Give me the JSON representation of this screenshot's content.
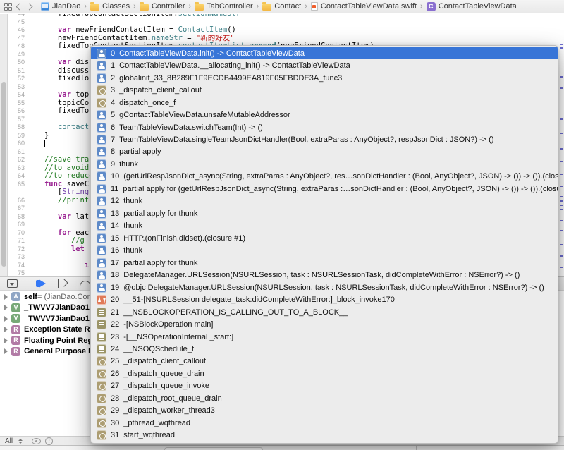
{
  "jumpbar": {
    "items": [
      {
        "icon": "project-icon",
        "label": "JianDao"
      },
      {
        "icon": "folder-icon",
        "label": "Classes"
      },
      {
        "icon": "folder-icon",
        "label": "Controller"
      },
      {
        "icon": "folder-icon",
        "label": "TabController"
      },
      {
        "icon": "folder-icon",
        "label": "Contact"
      },
      {
        "icon": "swift-file-icon",
        "label": "ContactTableViewData.swift"
      },
      {
        "icon": "class-icon",
        "label": "ContactTableViewData"
      }
    ]
  },
  "editor": {
    "lines": [
      {
        "n": "44",
        "seg": [
          [
            "n",
            "      fixedTopContactSectionItem."
          ],
          [
            "p",
            "sectionNameStr"
          ]
        ]
      },
      {
        "n": "45",
        "seg": []
      },
      {
        "n": "46",
        "seg": [
          [
            "n",
            "      "
          ],
          [
            "k",
            "var"
          ],
          [
            "n",
            " newFriendContactItem = "
          ],
          [
            "t",
            "ContactItem"
          ],
          [
            "n",
            "()"
          ]
        ]
      },
      {
        "n": "47",
        "seg": [
          [
            "n",
            "      newFriendContactItem."
          ],
          [
            "p",
            "nameStr"
          ],
          [
            "n",
            " = "
          ],
          [
            "s",
            "\"新的好友\""
          ]
        ]
      },
      {
        "n": "48",
        "seg": [
          [
            "n",
            "      fixedTopContactSectionItem."
          ],
          [
            "p",
            "contactItemList"
          ],
          [
            "n",
            "."
          ],
          [
            "pb",
            "append"
          ],
          [
            "n",
            "(newFriendContactItem)"
          ]
        ]
      },
      {
        "n": "49",
        "seg": []
      },
      {
        "n": "50",
        "seg": [
          [
            "n",
            "      "
          ],
          [
            "k",
            "var"
          ],
          [
            "n",
            " dis"
          ]
        ]
      },
      {
        "n": "51",
        "seg": [
          [
            "n",
            "      discuss"
          ]
        ]
      },
      {
        "n": "52",
        "seg": [
          [
            "n",
            "      fixedTo"
          ]
        ]
      },
      {
        "n": "53",
        "seg": []
      },
      {
        "n": "54",
        "seg": [
          [
            "n",
            "      "
          ],
          [
            "k",
            "var"
          ],
          [
            "n",
            " top"
          ]
        ]
      },
      {
        "n": "55",
        "seg": [
          [
            "n",
            "      topicCo"
          ]
        ]
      },
      {
        "n": "56",
        "seg": [
          [
            "n",
            "      fixedTo"
          ]
        ]
      },
      {
        "n": "57",
        "seg": []
      },
      {
        "n": "58",
        "seg": [
          [
            "n",
            "      "
          ],
          [
            "p",
            "contact"
          ]
        ]
      },
      {
        "n": "59",
        "seg": [
          [
            "n",
            "   }"
          ]
        ]
      },
      {
        "n": "60",
        "seg": [
          [
            "n",
            "   "
          ]
        ],
        "caret": true
      },
      {
        "n": "61",
        "seg": []
      },
      {
        "n": "62",
        "seg": [
          [
            "n",
            "   "
          ],
          [
            "c",
            "//save tran"
          ]
        ]
      },
      {
        "n": "63",
        "seg": [
          [
            "n",
            "   "
          ],
          [
            "c",
            "//to avoid"
          ]
        ]
      },
      {
        "n": "64",
        "seg": [
          [
            "n",
            "   "
          ],
          [
            "c",
            "//to reduce"
          ]
        ]
      },
      {
        "n": "65",
        "seg": [
          [
            "n",
            "   "
          ],
          [
            "k",
            "func"
          ],
          [
            "n",
            " saveCh"
          ]
        ]
      },
      {
        "n": "",
        "seg": [
          [
            "n",
            "      ["
          ],
          [
            "y",
            "String"
          ]
        ]
      },
      {
        "n": "66",
        "seg": [
          [
            "n",
            "      "
          ],
          [
            "c",
            "//print"
          ]
        ]
      },
      {
        "n": "67",
        "seg": []
      },
      {
        "n": "68",
        "seg": [
          [
            "n",
            "      "
          ],
          [
            "k",
            "var"
          ],
          [
            "n",
            " lat"
          ]
        ]
      },
      {
        "n": "69",
        "seg": []
      },
      {
        "n": "70",
        "seg": [
          [
            "n",
            "      "
          ],
          [
            "k",
            "for"
          ],
          [
            "n",
            " eac"
          ]
        ]
      },
      {
        "n": "71",
        "seg": [
          [
            "n",
            "         "
          ],
          [
            "c",
            "//g"
          ]
        ]
      },
      {
        "n": "72",
        "seg": [
          [
            "n",
            "         "
          ],
          [
            "k",
            "let"
          ]
        ]
      },
      {
        "n": "73",
        "seg": []
      },
      {
        "n": "74",
        "seg": [
          [
            "n",
            "            "
          ],
          [
            "k",
            "if"
          ]
        ]
      },
      {
        "n": "75",
        "seg": []
      }
    ],
    "mark_offsets": [
      42,
      47,
      88,
      104,
      148,
      168,
      190,
      208,
      226,
      243,
      258,
      264,
      270,
      276,
      292,
      306,
      326,
      342,
      358,
      372
    ]
  },
  "popup": {
    "selected_color": "#3875d7",
    "frames": [
      {
        "i": "0",
        "icon": "person-icon",
        "label": "ContactTableViewData.init() -> ContactTableViewData",
        "selected": true
      },
      {
        "i": "1",
        "icon": "person-icon",
        "label": "ContactTableViewData.__allocating_init() -> ContactTableViewData"
      },
      {
        "i": "2",
        "icon": "person-icon",
        "label": "globalinit_33_8B289F1F9ECDB4499EA819F05FBDDE3A_func3"
      },
      {
        "i": "3",
        "icon": "dispatch-icon",
        "label": "_dispatch_client_callout"
      },
      {
        "i": "4",
        "icon": "dispatch-icon",
        "label": "dispatch_once_f"
      },
      {
        "i": "5",
        "icon": "person-icon",
        "label": "gContactTableViewData.unsafeMutableAddressor"
      },
      {
        "i": "6",
        "icon": "person-icon",
        "label": "TeamTableViewData.switchTeam(Int) -> ()"
      },
      {
        "i": "7",
        "icon": "person-icon",
        "label": "TeamTableViewData.singleTeamJsonDictHandler(Bool, extraParas : AnyObject?, respJsonDict : JSON?) -> ()"
      },
      {
        "i": "8",
        "icon": "person-icon",
        "label": "partial apply"
      },
      {
        "i": "9",
        "icon": "person-icon",
        "label": "thunk"
      },
      {
        "i": "10",
        "icon": "person-icon",
        "label": "(getUrlRespJsonDict_async(String, extraParas : AnyObject?, res…sonDictHandler : (Bool, AnyObject?, JSON) -> ()) -> ()).(closure #1)"
      },
      {
        "i": "11",
        "icon": "person-icon",
        "label": "partial apply for (getUrlRespJsonDict_async(String, extraParas :…sonDictHandler : (Bool, AnyObject?, JSON) -> ()) -> ()).(closure #1)"
      },
      {
        "i": "12",
        "icon": "person-icon",
        "label": "thunk"
      },
      {
        "i": "13",
        "icon": "person-icon",
        "label": "partial apply for thunk"
      },
      {
        "i": "14",
        "icon": "person-icon",
        "label": "thunk"
      },
      {
        "i": "15",
        "icon": "person-icon",
        "label": "HTTP.(onFinish.didset).(closure #1)"
      },
      {
        "i": "16",
        "icon": "person-icon",
        "label": "thunk"
      },
      {
        "i": "17",
        "icon": "person-icon",
        "label": "partial apply for thunk"
      },
      {
        "i": "18",
        "icon": "person-icon",
        "label": "DelegateManager.URLSession(NSURLSession, task : NSURLSessionTask, didCompleteWithError : NSError?) -> ()"
      },
      {
        "i": "19",
        "icon": "person-icon",
        "label": "@objc DelegateManager.URLSession(NSURLSession, task : NSURLSessionTask, didCompleteWithError : NSError?) -> ()"
      },
      {
        "i": "20",
        "icon": "block-invoke-icon",
        "label": "__51-[NSURLSession delegate_task:didCompleteWithError:]_block_invoke170"
      },
      {
        "i": "21",
        "icon": "objc-frame-icon",
        "label": "__NSBLOCKOPERATION_IS_CALLING_OUT_TO_A_BLOCK__"
      },
      {
        "i": "22",
        "icon": "objc-frame-icon",
        "label": "-[NSBlockOperation main]"
      },
      {
        "i": "23",
        "icon": "objc-frame-icon",
        "label": "-[__NSOperationInternal _start:]"
      },
      {
        "i": "24",
        "icon": "objc-frame-icon",
        "label": "__NSOQSchedule_f"
      },
      {
        "i": "25",
        "icon": "dispatch-icon",
        "label": "_dispatch_client_callout"
      },
      {
        "i": "26",
        "icon": "dispatch-icon",
        "label": "_dispatch_queue_drain"
      },
      {
        "i": "27",
        "icon": "dispatch-icon",
        "label": "_dispatch_queue_invoke"
      },
      {
        "i": "28",
        "icon": "dispatch-icon",
        "label": "_dispatch_root_queue_drain"
      },
      {
        "i": "29",
        "icon": "dispatch-icon",
        "label": "_dispatch_worker_thread3"
      },
      {
        "i": "30",
        "icon": "dispatch-icon",
        "label": "_pthread_wqthread"
      },
      {
        "i": "31",
        "icon": "dispatch-icon",
        "label": "start_wqthread"
      }
    ]
  },
  "debug": {
    "variables": [
      {
        "badge": "A",
        "badge_color": "#8fa5c4",
        "name": "self",
        "value": " = (JianDao.Con"
      },
      {
        "badge": "V",
        "badge_color": "#77a877",
        "name": "_TWVV7JianDao11",
        "value": ""
      },
      {
        "badge": "V",
        "badge_color": "#77a877",
        "name": "_TWVV7JianDao18",
        "value": ""
      },
      {
        "badge": "R",
        "badge_color": "#b27ba6",
        "name": "Exception State R",
        "value": ""
      },
      {
        "badge": "R",
        "badge_color": "#b27ba6",
        "name": "Floating Point Reg",
        "value": ""
      },
      {
        "badge": "R",
        "badge_color": "#b27ba6",
        "name": "General Purpose R",
        "value": ""
      }
    ],
    "filter_label": "All"
  },
  "colors": {
    "selection_blue": "#3875d7",
    "breakpoint_blue": "#3478f6",
    "keyword_pink": "#9b2393",
    "string_red": "#c41a16",
    "comment_green": "#1e7a1e",
    "type_teal": "#3e8087"
  }
}
